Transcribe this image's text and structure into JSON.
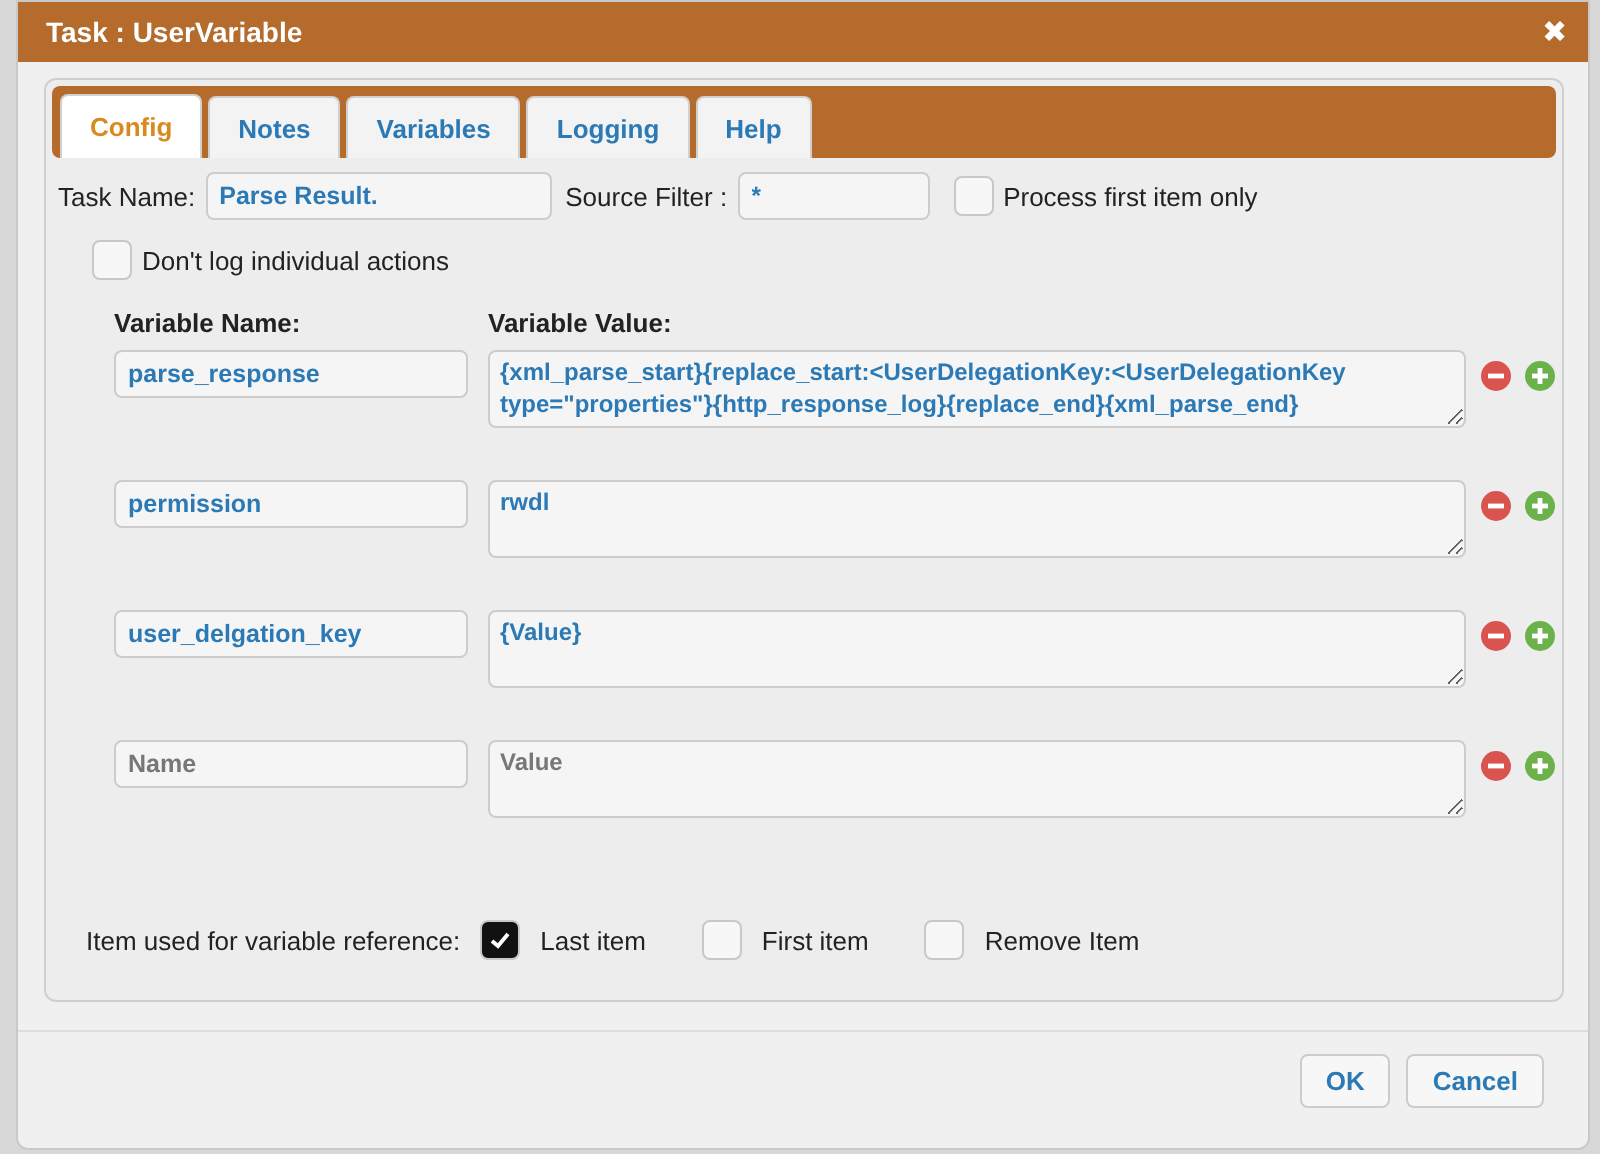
{
  "window": {
    "title": "Task : UserVariable",
    "close": "✖"
  },
  "tabs": [
    {
      "label": "Config",
      "selected": true
    },
    {
      "label": "Notes",
      "selected": false
    },
    {
      "label": "Variables",
      "selected": false
    },
    {
      "label": "Logging",
      "selected": false
    },
    {
      "label": "Help",
      "selected": false
    }
  ],
  "task_name": {
    "label": "Task Name:",
    "value": "Parse Result."
  },
  "source_filter": {
    "label": "Source Filter :",
    "value": "*"
  },
  "process_first": {
    "label": "Process first item only",
    "checked": false
  },
  "dont_log": {
    "label": "Don't log individual actions",
    "checked": false
  },
  "variables": {
    "name_header": "Variable Name:",
    "value_header": "Variable Value:",
    "rows": [
      {
        "name": {
          "value": "parse_response"
        },
        "value": {
          "value": "{xml_parse_start}{replace_start:<UserDelegationKey:<UserDelegationKey type=\"properties\"}{http_response_log}{replace_end}{xml_parse_end}"
        }
      },
      {
        "name": {
          "value": "permission"
        },
        "value": {
          "value": "rwdl"
        }
      },
      {
        "name": {
          "value": "user_delgation_key"
        },
        "value": {
          "value": "{Value}"
        }
      },
      {
        "name": {
          "placeholder": "Name"
        },
        "value": {
          "placeholder": "Value"
        }
      }
    ]
  },
  "reference": {
    "label": "Item used for variable reference:",
    "options": [
      {
        "label": "Last item",
        "checked": true
      },
      {
        "label": "First item",
        "checked": false
      },
      {
        "label": "Remove Item",
        "checked": false
      }
    ]
  },
  "buttons": [
    "OK",
    "Cancel"
  ]
}
